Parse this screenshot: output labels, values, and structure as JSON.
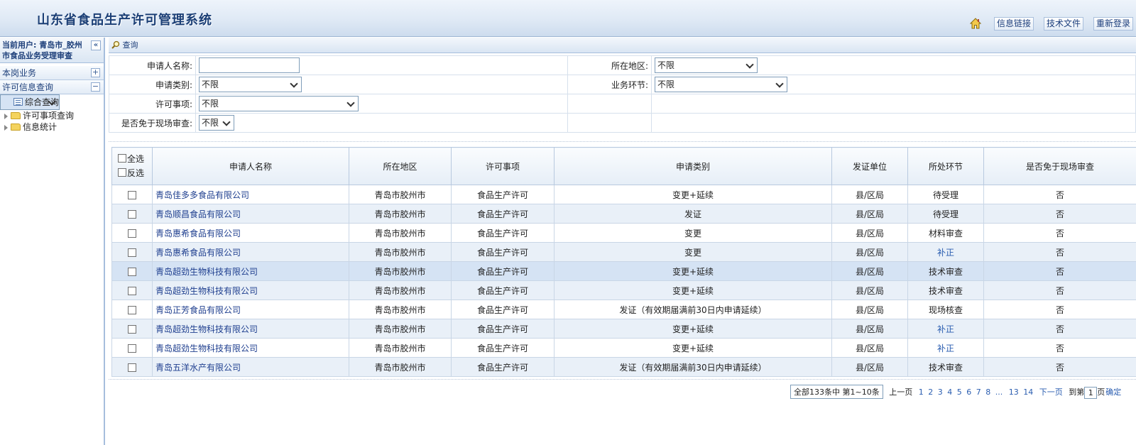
{
  "header": {
    "title": "山东省食品生产许可管理系统",
    "links": [
      "信息链接",
      "技术文件",
      "重新登录"
    ]
  },
  "sidebar": {
    "current_user_line1": "当前用户: 青岛市_胶州",
    "current_user_line2": "市食品业务受理审查",
    "collapse_glyph": "«",
    "sections": [
      {
        "label": "本岗业务",
        "toggle": "+"
      },
      {
        "label": "许可信息查询",
        "toggle": "−"
      }
    ],
    "tree": [
      {
        "label": "综合查询",
        "selected": true,
        "type": "doc"
      },
      {
        "label": "许可事项查询",
        "type": "folder"
      },
      {
        "label": "信息统计",
        "type": "folder"
      }
    ]
  },
  "panel": {
    "title": "查询"
  },
  "form": {
    "applicant_label": "申请人名称:",
    "applicant_value": "",
    "region_label": "所在地区:",
    "region_value": "不限",
    "type_label": "申请类别:",
    "type_value": "不限",
    "stage_label": "业务环节:",
    "stage_value": "不限",
    "item_label": "许可事项:",
    "item_value": "不限",
    "exempt_label": "是否免于现场审查:",
    "exempt_value": "不限"
  },
  "table": {
    "select_all": "全选",
    "invert": "反选",
    "columns": [
      "申请人名称",
      "所在地区",
      "许可事项",
      "申请类别",
      "发证单位",
      "所处环节",
      "是否免于现场审查"
    ],
    "rows": [
      {
        "name": "青岛佳多多食品有限公司",
        "region": "青岛市胶州市",
        "item": "食品生产许可",
        "type": "变更+延续",
        "issuer": "县/区局",
        "stage": "待受理",
        "exempt": "否"
      },
      {
        "name": "青岛顺昌食品有限公司",
        "region": "青岛市胶州市",
        "item": "食品生产许可",
        "type": "发证",
        "issuer": "县/区局",
        "stage": "待受理",
        "exempt": "否"
      },
      {
        "name": "青岛惠希食品有限公司",
        "region": "青岛市胶州市",
        "item": "食品生产许可",
        "type": "变更",
        "issuer": "县/区局",
        "stage": "材料审查",
        "exempt": "否"
      },
      {
        "name": "青岛惠希食品有限公司",
        "region": "青岛市胶州市",
        "item": "食品生产许可",
        "type": "变更",
        "issuer": "县/区局",
        "stage": "补正",
        "exempt": "否"
      },
      {
        "name": "青岛超劲生物科技有限公司",
        "region": "青岛市胶州市",
        "item": "食品生产许可",
        "type": "变更+延续",
        "issuer": "县/区局",
        "stage": "技术审查",
        "exempt": "否"
      },
      {
        "name": "青岛超劲生物科技有限公司",
        "region": "青岛市胶州市",
        "item": "食品生产许可",
        "type": "变更+延续",
        "issuer": "县/区局",
        "stage": "技术审查",
        "exempt": "否"
      },
      {
        "name": "青岛正芳食品有限公司",
        "region": "青岛市胶州市",
        "item": "食品生产许可",
        "type": "发证（有效期届满前30日内申请延续）",
        "issuer": "县/区局",
        "stage": "现场核查",
        "exempt": "否"
      },
      {
        "name": "青岛超劲生物科技有限公司",
        "region": "青岛市胶州市",
        "item": "食品生产许可",
        "type": "变更+延续",
        "issuer": "县/区局",
        "stage": "补正",
        "exempt": "否"
      },
      {
        "name": "青岛超劲生物科技有限公司",
        "region": "青岛市胶州市",
        "item": "食品生产许可",
        "type": "变更+延续",
        "issuer": "县/区局",
        "stage": "补正",
        "exempt": "否"
      },
      {
        "name": "青岛五洋水产有限公司",
        "region": "青岛市胶州市",
        "item": "食品生产许可",
        "type": "发证（有效期届满前30日内申请延续）",
        "issuer": "县/区局",
        "stage": "技术审查",
        "exempt": "否"
      }
    ]
  },
  "pager": {
    "summary": "全部133条中 第1~10条",
    "prev": "上一页",
    "pages": [
      "1",
      "2",
      "3",
      "4",
      "5",
      "6",
      "7",
      "8"
    ],
    "ellipsis": "...",
    "tail_pages": [
      "13",
      "14"
    ],
    "next": "下一页",
    "goto_prefix": "到第",
    "goto_value": "1",
    "goto_suffix": "页",
    "confirm": "确定"
  },
  "colors": {
    "accent": "#1b3f76",
    "link": "#2a5db0",
    "row_alt": "#e9f0f8",
    "row_highlight": "#d5e3f4"
  }
}
